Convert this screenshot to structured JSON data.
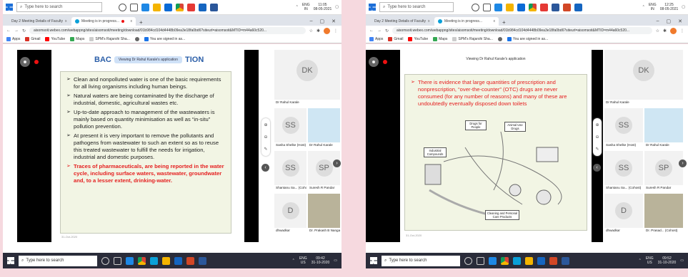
{
  "left": {
    "taskbar": {
      "search_placeholder": "Type here to search",
      "lang": "ENG",
      "region": "IN",
      "time": "11:05",
      "date": "08-05-2021"
    },
    "tabs": [
      {
        "label": "Day 2 Meeting Details of Faculty",
        "close": "x"
      },
      {
        "label": "Meeting is in progress...",
        "close": "x"
      }
    ],
    "new_tab": "+",
    "url": "aisomsoit.webex.com/webappng/sites/aisomsoit/meeting/download/01b984cd104d4448b09ea3e18fa0bd6?siteurl=aisomsoit&MTID=m44a60c520...",
    "bookmarks": [
      "Apps",
      "Gmail",
      "YouTube",
      "Maps",
      "SPM's Rajarshi Sha...",
      "",
      "You are signed in as..."
    ],
    "viewing_label": "Viewing Dr Rahul Karale's application",
    "slide_title_left": "BAC",
    "slide_title_right": "TION",
    "bullets": [
      {
        "text": "Clean and nonpolluted water is one of the basic requirements for all living organisms including human beings.",
        "red": false
      },
      {
        "text": "Natural waters are being contaminated by the discharge of industrial, domestic, agricultural wastes etc.",
        "red": false
      },
      {
        "text": "Up-to-date approach to management of the wastewaters is mainly based on quantity minimisation as well as “in-situ” pollution prevention.",
        "red": false
      },
      {
        "text": "At present it is very important to remove the pollutants and pathogens from wastewater to such an extent so as to reuse this treated wastewater to fulfill the needs for irrigation, industrial and domestic purposes.",
        "red": false
      },
      {
        "text": "Traces of pharmaceuticals, are being reported in the water cycle, including surface waters, wastewater, groundwater and, to a lesser extent, drinking-water.",
        "red": true
      }
    ],
    "slide_date": "31-Oct-2020",
    "participants": {
      "host_initials": "DK",
      "host_name": "Dr Rahul Karale",
      "tiles": [
        {
          "initials": "SS",
          "name": "Sasha Shelke (Host)"
        },
        {
          "initials": "",
          "name": "Dr Rahul Karale"
        },
        {
          "initials": "SS",
          "name": "Shantanu Sa... (Cohost)"
        },
        {
          "initials": "SP",
          "name": "Suresh R Pandar"
        },
        {
          "initials": "D",
          "name": "dhwadkar"
        },
        {
          "initials": "",
          "name": "Dr. Prakash B Nangare"
        }
      ]
    },
    "bottom_taskbar": {
      "search_placeholder": "Type here to search",
      "lang": "ENG",
      "region": "US",
      "time": "09:42",
      "date": "31-10-2020"
    }
  },
  "right": {
    "taskbar": {
      "search_placeholder": "Type here to search",
      "lang": "ENG",
      "region": "IN",
      "time": "12:25",
      "date": "08-05-2021"
    },
    "tabs": [
      {
        "label": "Day 2 Meeting Details of Faculty",
        "close": "x"
      },
      {
        "label": "Meeting is in progress...",
        "close": "x"
      }
    ],
    "new_tab": "+",
    "url": "aisomsoit.webex.com/webappng/sites/aisomsoit/meeting/download/01b984cd104d4448b09ea3e18fa0bd6?siteurl=aisomsoit&MTID=m44a60c520...",
    "bookmarks": [
      "Apps",
      "Gmail",
      "YouTube",
      "Maps",
      "SPM's Rajarshi Sha...",
      "",
      "You are signed in as..."
    ],
    "viewing_label": "Viewing Dr Rahul Karale's application",
    "bullet": "There is evidence that large quantities of prescription and nonprescription, “over-the-counter” (OTC) drugs are never consumed (for any number of reasons) and many of these are undoubtedly eventually disposed down toilets",
    "diagram_labels": {
      "drugs_people": "Drugs for People",
      "animal_drugs": "Animal Use Drugs",
      "industrial": "Industrial Compounds",
      "cleaning": "Cleaning and Personal Care Products"
    },
    "slide_date": "31-Oct-2020",
    "participants": {
      "host_initials": "DK",
      "host_name": "Dr Rahul Karale",
      "tiles": [
        {
          "initials": "SS",
          "name": "Sasha Shelke (Host)"
        },
        {
          "initials": "",
          "name": "Dr Rahul Karale"
        },
        {
          "initials": "SS",
          "name": "Shantanu Sa... (Cohost)"
        },
        {
          "initials": "SP",
          "name": "Suresh R Pandar"
        },
        {
          "initials": "D",
          "name": "dhwadkar"
        },
        {
          "initials": "",
          "name": "Dr. Prasad... (Cohost)"
        }
      ]
    },
    "bottom_taskbar": {
      "search_placeholder": "Type here to search",
      "lang": "ENG",
      "region": "US",
      "time": "09:52",
      "date": "31-10-2020"
    }
  }
}
